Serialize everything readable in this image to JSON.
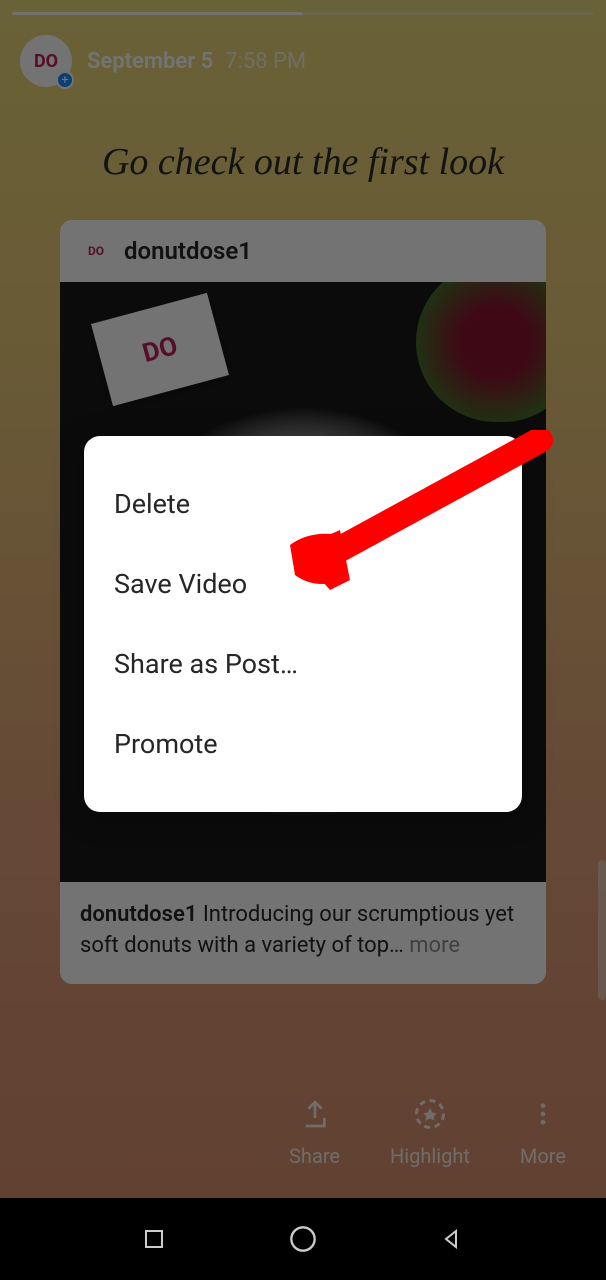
{
  "header": {
    "date": "September 5",
    "time": "7:58 PM"
  },
  "story": {
    "caption": "Go check out the first look"
  },
  "post": {
    "username": "donutdose1",
    "caption_user": "donutdose1",
    "caption_text": " Introducing our scrumptious yet soft donuts with a variety of top…",
    "more_label": " more"
  },
  "menu": {
    "items": [
      {
        "label": "Delete"
      },
      {
        "label": "Save Video"
      },
      {
        "label": "Share as Post…"
      },
      {
        "label": "Promote"
      }
    ]
  },
  "actions": {
    "share": "Share",
    "highlight": "Highlight",
    "more": "More"
  }
}
